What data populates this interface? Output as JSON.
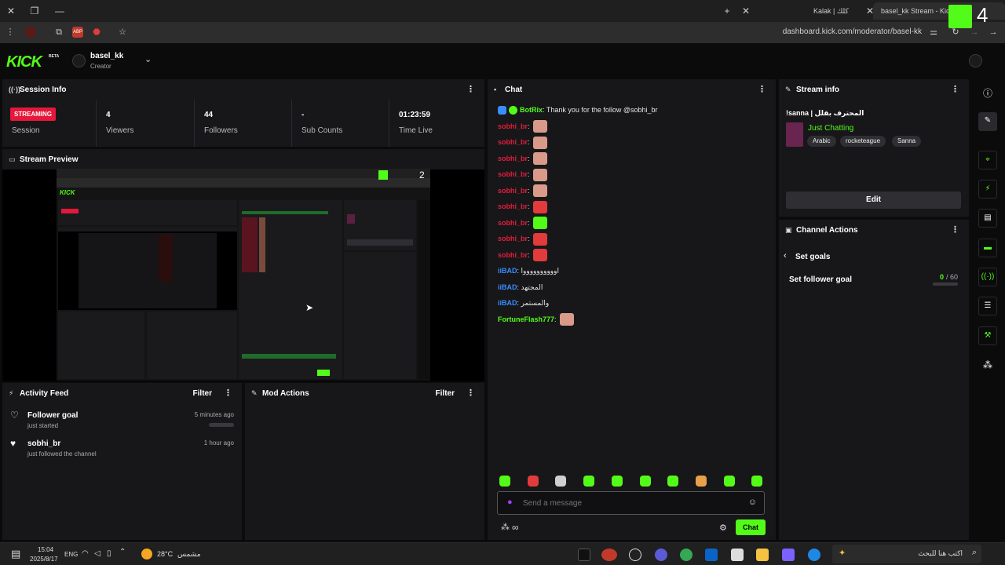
{
  "browser": {
    "tabs": [
      {
        "label": "Kalak | كلك"
      },
      {
        "label": "basel_kk Stream - Kick Da"
      }
    ],
    "url": "dashboard.kick.com/moderator/basel-kk",
    "overlay_badge": "4"
  },
  "header": {
    "logo": "KICK",
    "beta": "BETA",
    "username": "basel_kk",
    "role": "Creator"
  },
  "session": {
    "title": "Session Info",
    "status": "STREAMING",
    "stats": [
      {
        "label": "Session",
        "value": ""
      },
      {
        "label": "Viewers",
        "value": "4"
      },
      {
        "label": "Followers",
        "value": "44"
      },
      {
        "label": "Sub Counts",
        "value": "-"
      },
      {
        "label": "Time Live",
        "value": "01:23:59"
      }
    ]
  },
  "preview": {
    "title": "Stream Preview",
    "inner_badge": "2"
  },
  "activity": {
    "title": "Activity Feed",
    "filter": "Filter",
    "items": [
      {
        "title": "Follower goal",
        "sub": "just started",
        "time": "5 minutes ago"
      },
      {
        "title": "sobhi_br",
        "sub": "just followed the channel",
        "time": "1 hour ago"
      }
    ]
  },
  "mod_actions": {
    "title": "Mod Actions",
    "filter": "Filter"
  },
  "chat": {
    "title": "Chat",
    "messages": [
      {
        "user": "BotRix",
        "text": "Thank you for the follow @sobhi_br",
        "color": "green"
      },
      {
        "user": "sobhi_br",
        "text": "",
        "color": "red",
        "emote": "face"
      },
      {
        "user": "sobhi_br",
        "text": "",
        "color": "red",
        "emote": "face"
      },
      {
        "user": "sobhi_br",
        "text": "",
        "color": "red",
        "emote": "face"
      },
      {
        "user": "sobhi_br",
        "text": "",
        "color": "red",
        "emote": "face"
      },
      {
        "user": "sobhi_br",
        "text": "",
        "color": "red",
        "emote": "face"
      },
      {
        "user": "sobhi_br",
        "text": "",
        "color": "red",
        "emote": "red"
      },
      {
        "user": "sobhi_br",
        "text": "",
        "color": "red",
        "emote": "green"
      },
      {
        "user": "sobhi_br",
        "text": "",
        "color": "red",
        "emote": "red"
      },
      {
        "user": "sobhi_br",
        "text": "",
        "color": "red",
        "emote": "red"
      },
      {
        "user": "iiBAD",
        "text": "اووووووووووا",
        "color": "blue"
      },
      {
        "user": "iiBAD",
        "text": "المجتهد",
        "color": "blue"
      },
      {
        "user": "iiBAD",
        "text": "والمستمر",
        "color": "blue"
      },
      {
        "user": "FortuneFlash777",
        "text": "",
        "color": "green",
        "emote": "face"
      }
    ],
    "input_placeholder": "Send a message",
    "send_label": "Chat",
    "points_label": "∞"
  },
  "stream_info": {
    "title": "Stream info",
    "stream_title": "!sanna | المحترف بقلل",
    "category": "Just Chatting",
    "tags": [
      "Arabic",
      "rocketeague",
      "Sanna"
    ],
    "edit_label": "Edit"
  },
  "channel_actions": {
    "title": "Channel Actions",
    "back_label": "Set goals",
    "goal_label": "Set follower goal",
    "goal_current": "0",
    "goal_total": "/ 60",
    "goal_progress": 0
  },
  "taskbar": {
    "time": "15:04",
    "date": "2025/8/17",
    "lang": "ENG",
    "weather_temp": "28°C",
    "weather_desc": "مشمس",
    "search_placeholder": "اكتب هنا للبحث"
  },
  "colors": {
    "accent": "#53fc18",
    "streaming": "#e5173a",
    "panel": "#17171a"
  }
}
